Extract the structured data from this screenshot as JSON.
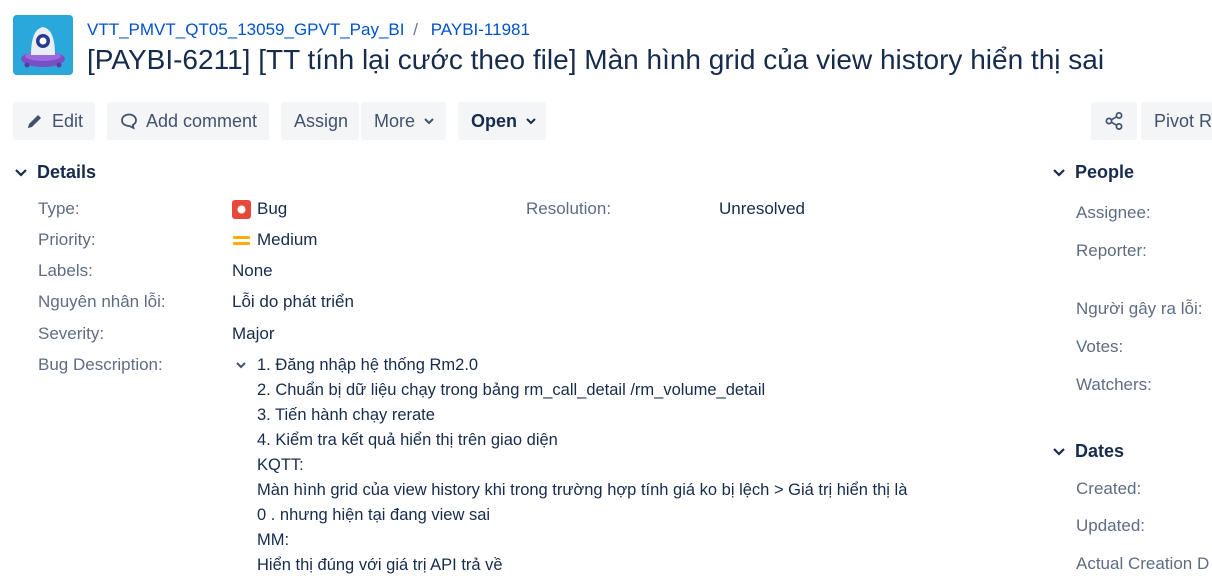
{
  "breadcrumb": {
    "project": "VTT_PMVT_QT05_13059_GPVT_Pay_BI",
    "separator": "/",
    "parent_issue": "PAYBI-11981"
  },
  "issue": {
    "title": "[PAYBI-6211] [TT tính lại cước theo file] Màn hình grid của view history hiển thị sai"
  },
  "toolbar": {
    "edit": "Edit",
    "add_comment": "Add comment",
    "assign": "Assign",
    "more": "More",
    "status": "Open",
    "pivot": "Pivot Re"
  },
  "details": {
    "heading": "Details",
    "fields": [
      {
        "label": "Type:",
        "value": "Bug"
      },
      {
        "label": "Priority:",
        "value": "Medium"
      },
      {
        "label": "Labels:",
        "value": "None"
      },
      {
        "label": "Nguyên nhân lỗi:",
        "value": "Lỗi do phát triển"
      },
      {
        "label": "Severity:",
        "value": "Major"
      },
      {
        "label": "Bug Description:",
        "value": ""
      }
    ],
    "resolution_label": "Resolution:",
    "resolution_value": "Unresolved",
    "description_lines": [
      "1. Đăng nhập hệ thống Rm2.0",
      "2. Chuẩn bị dữ liệu chạy trong bảng rm_call_detail /rm_volume_detail",
      "3. Tiến hành chạy rerate",
      "4. Kiểm tra kết quả hiển thị trên giao diện",
      "KQTT:",
      "Màn hình grid của view history khi trong trường hợp tính giá ko bị lệch > Giá trị hiển thị là",
      "0 . nhưng hiện tại đang view sai",
      "MM:",
      "Hiển thị đúng với giá trị API trả về"
    ]
  },
  "people": {
    "heading": "People",
    "labels": [
      "Assignee:",
      "Reporter:",
      "Người gây ra lỗi:",
      "Votes:",
      "Watchers:"
    ]
  },
  "dates": {
    "heading": "Dates",
    "labels": [
      "Created:",
      "Updated:",
      "Actual Creation D"
    ]
  },
  "colors": {
    "link": "#0052cc",
    "text": "#172b4d",
    "label": "#5e6c84",
    "button_bg": "#f4f5f7",
    "bug_red": "#e5493a",
    "priority_medium": "#ffab00",
    "avatar_bg": "#2aa8dc"
  }
}
